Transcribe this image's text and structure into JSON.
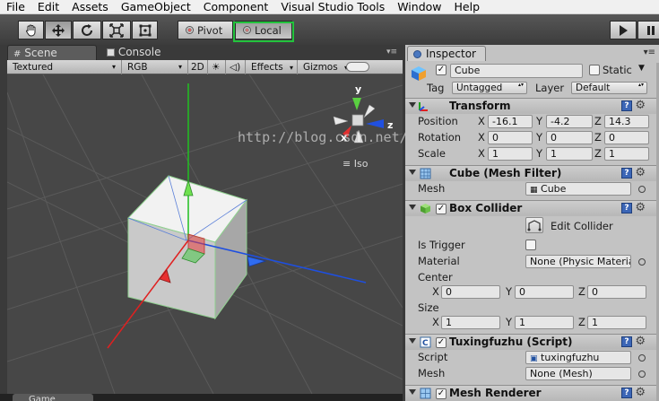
{
  "menu": [
    "File",
    "Edit",
    "Assets",
    "GameObject",
    "Component",
    "Visual Studio Tools",
    "Window",
    "Help"
  ],
  "toolbar": {
    "pivot_label": "Pivot",
    "local_label": "Local"
  },
  "tabs": {
    "scene": "Scene",
    "console": "Console",
    "inspector": "Inspector"
  },
  "scene_bar": {
    "shading": "Textured",
    "render_mode": "RGB",
    "mode_2d": "2D",
    "effects": "Effects",
    "gizmos": "Gizmos"
  },
  "scene": {
    "view_mode": "Iso",
    "axis_labels": {
      "y": "y",
      "x": "x",
      "z": "z"
    },
    "watermark": "http://blog.csdn.net/"
  },
  "inspector": {
    "object_name": "Cube",
    "static_label": "Static",
    "tag_label": "Tag",
    "tag_value": "Untagged",
    "layer_label": "Layer",
    "layer_value": "Default",
    "transform": {
      "title": "Transform",
      "position_label": "Position",
      "rotation_label": "Rotation",
      "scale_label": "Scale",
      "position": {
        "x": "-16.1",
        "y": "-4.2",
        "z": "14.3"
      },
      "rotation": {
        "x": "0",
        "y": "0",
        "z": "0"
      },
      "scale": {
        "x": "1",
        "y": "1",
        "z": "1"
      }
    },
    "mesh_filter": {
      "title": "Cube (Mesh Filter)",
      "mesh_label": "Mesh",
      "mesh_value": "Cube"
    },
    "box_collider": {
      "title": "Box Collider",
      "edit_collider": "Edit Collider",
      "is_trigger_label": "Is Trigger",
      "material_label": "Material",
      "material_value": "None (Physic Materia",
      "center_label": "Center",
      "center": {
        "x": "0",
        "y": "0",
        "z": "0"
      },
      "size_label": "Size",
      "size": {
        "x": "1",
        "y": "1",
        "z": "1"
      }
    },
    "script_component": {
      "title": "Tuxingfuzhu (Script)",
      "script_label": "Script",
      "script_value": "tuxingfuzhu",
      "mesh_label": "Mesh",
      "mesh_value": "None (Mesh)"
    },
    "mesh_renderer": {
      "title": "Mesh Renderer"
    }
  },
  "axis_letters": {
    "x": "X",
    "y": "Y",
    "z": "Z"
  },
  "colors": {
    "axis_x": "#e02020",
    "axis_y": "#20c020",
    "axis_z": "#1e4fe0",
    "selection": "#22c33c",
    "help_blue": "#3c66b6"
  }
}
